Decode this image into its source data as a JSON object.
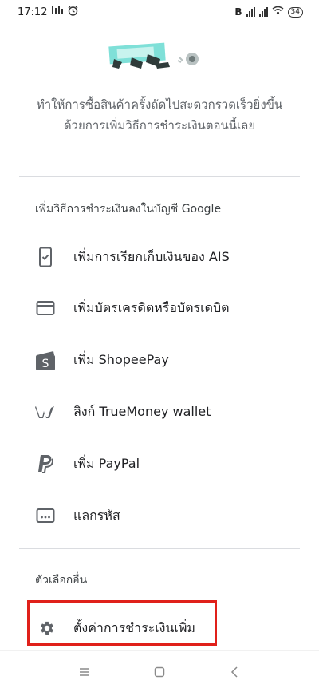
{
  "status_bar": {
    "time": "17:12",
    "bluetooth_label": "B",
    "battery": "34"
  },
  "promo": {
    "line1": "ทำให้การซื้อสินค้าครั้งถัดไปสะดวกรวดเร็วยิ่งขึ้น",
    "line2": "ด้วยการเพิ่มวิธีการชำระเงินตอนนี้เลย"
  },
  "section_add": {
    "title": "เพิ่มวิธีการชำระเงินลงในบัญชี Google"
  },
  "payment_options": [
    {
      "label": "เพิ่มการเรียกเก็บเงินของ AIS",
      "icon": "phone-billing-icon"
    },
    {
      "label": "เพิ่มบัตรเครดิตหรือบัตรเดบิต",
      "icon": "credit-card-icon"
    },
    {
      "label": "เพิ่ม ShopeePay",
      "icon": "shopeepay-icon"
    },
    {
      "label": "ลิงก์ TrueMoney wallet",
      "icon": "truemoney-icon"
    },
    {
      "label": "เพิ่ม PayPal",
      "icon": "paypal-icon"
    },
    {
      "label": "แลกรหัส",
      "icon": "redeem-code-icon"
    }
  ],
  "section_other": {
    "title": "ตัวเลือกอื่น",
    "settings_label": "ตั้งค่าการชำระเงินเพิ่ม",
    "settings_icon": "gear-icon"
  },
  "colors": {
    "highlight": "#e0201a",
    "icon": "#5f6368"
  }
}
